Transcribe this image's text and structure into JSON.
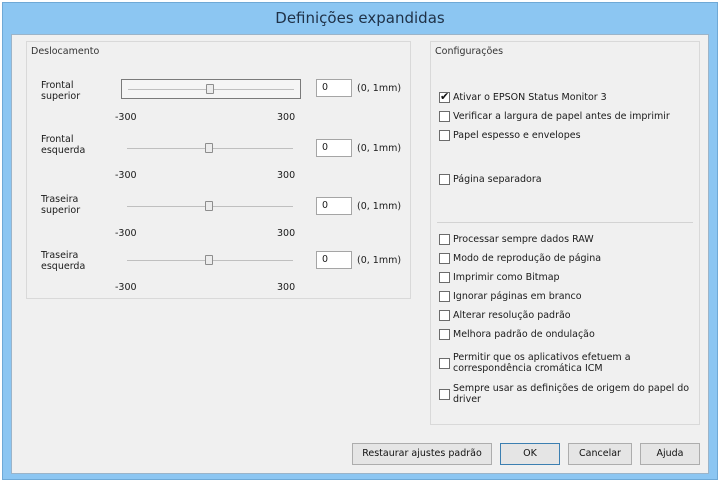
{
  "window": {
    "title": "Definições expandidas"
  },
  "offset": {
    "title": "Deslocamento",
    "unit": "(0, 1mm)",
    "min_label": "-300",
    "max_label": "300",
    "rows": [
      {
        "label_line1": "Frontal",
        "label_line2": "superior",
        "value": "0"
      },
      {
        "label_line1": "Frontal",
        "label_line2": "esquerda",
        "value": "0"
      },
      {
        "label_line1": "Traseira",
        "label_line2": "superior",
        "value": "0"
      },
      {
        "label_line1": "Traseira",
        "label_line2": "esquerda",
        "value": "0"
      }
    ]
  },
  "settings": {
    "title": "Configurações",
    "top_options": [
      {
        "label": "Ativar o EPSON Status Monitor 3",
        "checked": true
      },
      {
        "label": "Verificar a largura de papel antes de imprimir",
        "checked": false
      },
      {
        "label": "Papel espesso e envelopes",
        "checked": false
      },
      {
        "label": "Página separadora",
        "checked": false
      }
    ],
    "bottom_options": [
      {
        "label": "Processar sempre dados RAW",
        "checked": false
      },
      {
        "label": "Modo de reprodução de página",
        "checked": false
      },
      {
        "label": "Imprimir como Bitmap",
        "checked": false
      },
      {
        "label": "Ignorar páginas em branco",
        "checked": false
      },
      {
        "label": "Alterar resolução padrão",
        "checked": false
      },
      {
        "label": "Melhora padrão de ondulação",
        "checked": false
      },
      {
        "label_line1": "Permitir que os aplicativos efetuem a",
        "label_line2": "correspondência cromática ICM",
        "checked": false
      },
      {
        "label_line1": "Sempre usar as definições de origem do papel do",
        "label_line2": "driver",
        "checked": false
      }
    ]
  },
  "buttons": {
    "restore": "Restaurar ajustes padrão",
    "ok": "OK",
    "cancel": "Cancelar",
    "help": "Ajuda"
  }
}
